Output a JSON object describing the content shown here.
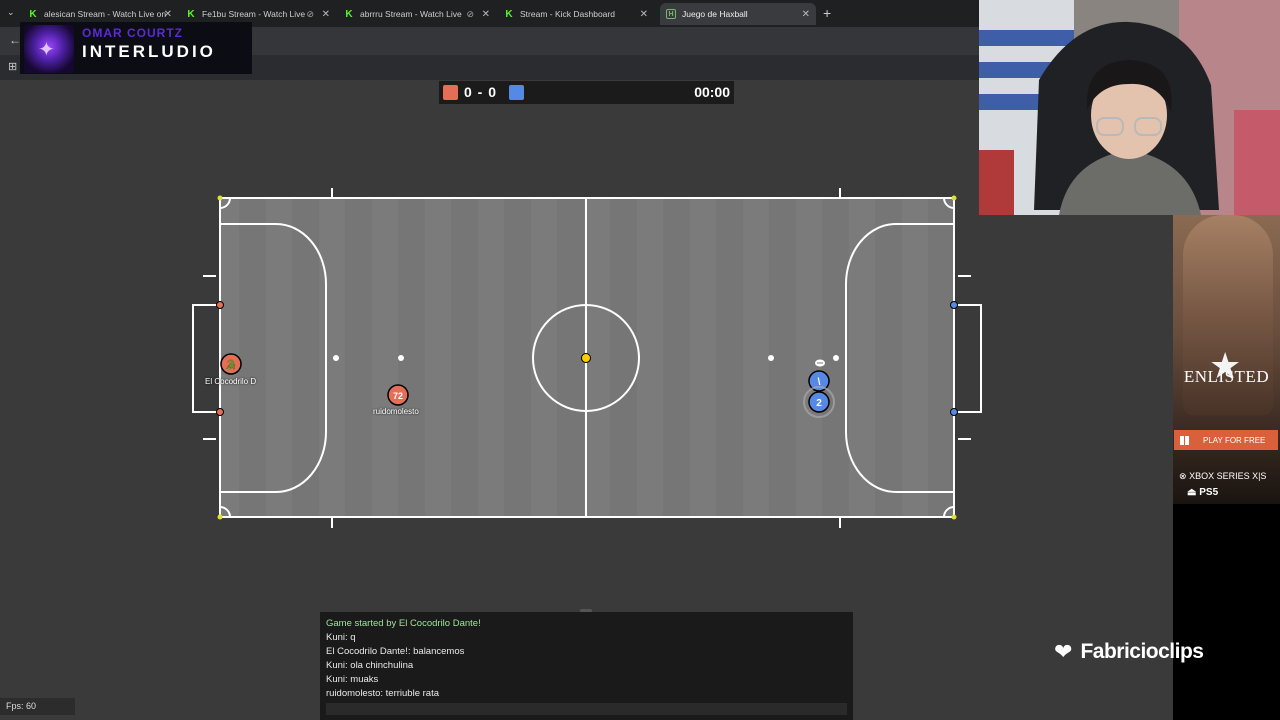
{
  "browser": {
    "tabs": [
      {
        "label": "alesican Stream - Watch Live on",
        "icon": "kick-icon"
      },
      {
        "label": "Fe1bu Stream - Watch Live",
        "icon": "kick-icon"
      },
      {
        "label": "abrrru Stream - Watch Live",
        "icon": "kick-icon"
      },
      {
        "label": "Stream - Kick Dashboard",
        "icon": "kick-icon"
      },
      {
        "label": "Juego de Haxball",
        "icon": "haxball-icon"
      }
    ],
    "active_tab_index": 4,
    "new_tab_label": "+"
  },
  "overlay": {
    "subtitle": "OMAR COURTZ",
    "title": "INTERLUDIO"
  },
  "scoreboard": {
    "score": "0 - 0",
    "time": "00:00",
    "red_color": "#e56e56",
    "blue_color": "#5689e5"
  },
  "players": [
    {
      "team": "red",
      "avatar": "crocodile-emoji",
      "name": "El Cocodrilo D"
    },
    {
      "team": "red",
      "avatar": "72",
      "name": "ruidomolesto"
    },
    {
      "team": "blue",
      "avatar": "\\",
      "name": ""
    },
    {
      "team": "blue",
      "avatar": "2",
      "name": ""
    }
  ],
  "chat": {
    "messages": [
      {
        "text": "Game started by El Cocodrilo Dante!",
        "kind": "notice"
      },
      {
        "text": "Kuni: q",
        "kind": "message"
      },
      {
        "text": "El Cocodrilo Dante!: balancemos",
        "kind": "message"
      },
      {
        "text": "Kuni: ola chinchulina",
        "kind": "message"
      },
      {
        "text": "Kuni: muaks",
        "kind": "message"
      },
      {
        "text": "ruidomolesto: terriuble rata",
        "kind": "message"
      }
    ]
  },
  "fps": "Fps: 60",
  "ad": {
    "brand": "ENLISTED",
    "cta": "PLAY FOR FREE",
    "platform1": "XBOX SERIES X|S",
    "platform2": "PS5"
  },
  "watermark": "Fabricioclips"
}
